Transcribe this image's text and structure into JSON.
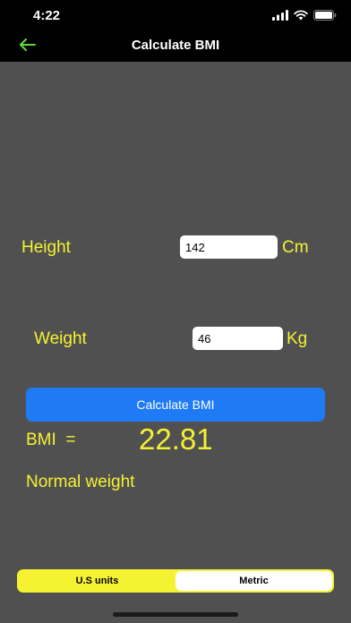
{
  "status_bar": {
    "time": "4:22",
    "icons": [
      "signal-icon",
      "wifi-icon",
      "battery-icon"
    ]
  },
  "nav": {
    "title": "Calculate BMI",
    "back_icon": "back-arrow-icon"
  },
  "form": {
    "height_label": "Height",
    "height_value": "142",
    "height_unit": "Cm",
    "weight_label": "Weight",
    "weight_value": "46",
    "weight_unit": "Kg"
  },
  "calculate_button": "Calculate BMI",
  "result": {
    "bmi_label": "BMI  =",
    "bmi_value": "22.81",
    "category": "Normal weight"
  },
  "units_segment": {
    "options": [
      "U.S units",
      "Metric"
    ],
    "selected": "Metric"
  },
  "colors": {
    "accent_yellow": "#f5f232",
    "button_blue": "#1e7bf5",
    "background": "#505050",
    "back_arrow": "#5fdc3c"
  }
}
